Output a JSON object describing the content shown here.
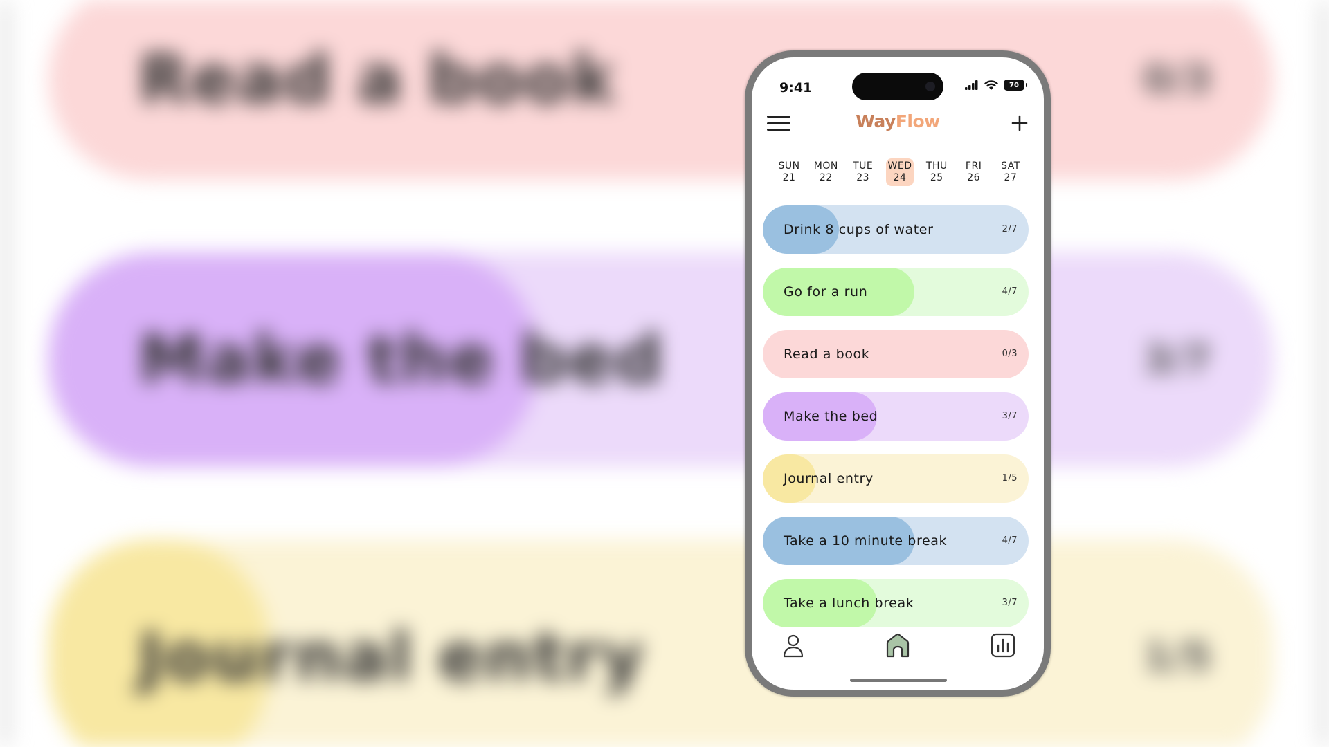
{
  "colors": {
    "accent": "#c8805a",
    "accent_light": "#f2a679",
    "selected_day": "#fcd5c0"
  },
  "background": {
    "items": [
      {
        "label": "Read a book",
        "count": "0/3",
        "track": "#fcd8d8",
        "fill": "#fcd8d8",
        "progress": 0
      },
      {
        "label": "Make the bed",
        "count": "3/7",
        "track": "#ecdafa",
        "fill": "#d9b1f8",
        "progress": 0.4
      },
      {
        "label": "Journal entry",
        "count": "1/5",
        "track": "#fbf3d6",
        "fill": "#f8e8a2",
        "progress": 0.18
      }
    ]
  },
  "status_bar": {
    "time": "9:41",
    "battery": "70",
    "icons": [
      "cellular-signal-icon",
      "wifi-icon",
      "battery-icon"
    ]
  },
  "header": {
    "brand_part1": "Way",
    "brand_part2": "Flow",
    "menu_icon": "hamburger-menu-icon",
    "add_icon": "plus-icon"
  },
  "week": [
    {
      "day": "SUN",
      "date": "21",
      "selected": false
    },
    {
      "day": "MON",
      "date": "22",
      "selected": false
    },
    {
      "day": "TUE",
      "date": "23",
      "selected": false
    },
    {
      "day": "WED",
      "date": "24",
      "selected": true
    },
    {
      "day": "THU",
      "date": "25",
      "selected": false
    },
    {
      "day": "FRI",
      "date": "26",
      "selected": false
    },
    {
      "day": "SAT",
      "date": "27",
      "selected": false
    }
  ],
  "habits": [
    {
      "label": "Drink 8 cups of water",
      "count": "2/7",
      "progress": 0.2857,
      "track": "#d3e2f1",
      "fill": "#9ac0e0"
    },
    {
      "label": "Go for a run",
      "count": "4/7",
      "progress": 0.5714,
      "track": "#e3fbdc",
      "fill": "#c1f8a9"
    },
    {
      "label": "Read a book",
      "count": "0/3",
      "progress": 0,
      "track": "#fcd8d8",
      "fill": "#f8b8b8"
    },
    {
      "label": "Make the bed",
      "count": "3/7",
      "progress": 0.4286,
      "track": "#ecdafa",
      "fill": "#d9b1f8"
    },
    {
      "label": "Journal entry",
      "count": "1/5",
      "progress": 0.2,
      "track": "#fbf3d6",
      "fill": "#f8e8a2"
    },
    {
      "label": "Take a 10 minute break",
      "count": "4/7",
      "progress": 0.5714,
      "track": "#d3e2f1",
      "fill": "#9ac0e0"
    },
    {
      "label": "Take a lunch break",
      "count": "3/7",
      "progress": 0.4286,
      "track": "#e3fbdc",
      "fill": "#c1f8a9"
    }
  ],
  "tab_bar": {
    "tabs": [
      {
        "icon": "profile-icon",
        "active": false
      },
      {
        "icon": "home-icon",
        "active": true
      },
      {
        "icon": "stats-icon",
        "active": false
      }
    ]
  }
}
